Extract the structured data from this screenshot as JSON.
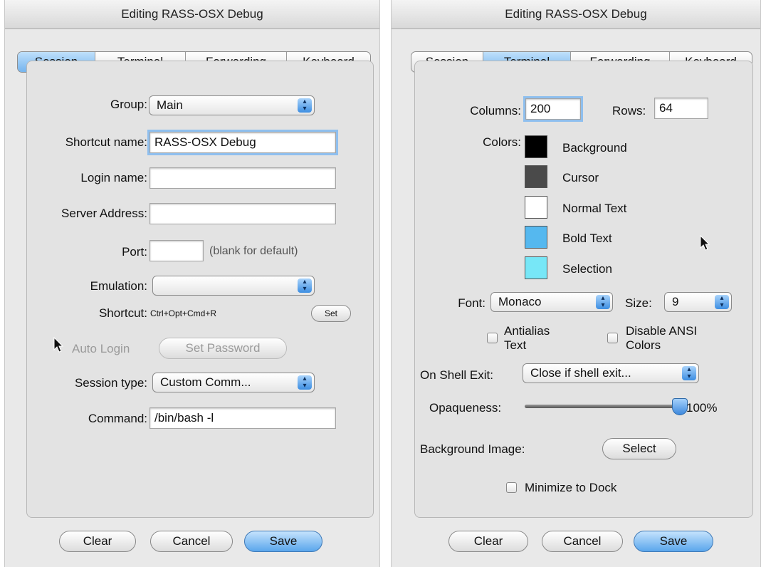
{
  "left": {
    "title": "Editing RASS-OSX Debug",
    "tabs": [
      "Session",
      "Terminal",
      "Forwarding",
      "Keyboard"
    ],
    "active_tab": "Session",
    "group_label": "Group:",
    "group_value": "Main",
    "shortcut_name_label": "Shortcut name:",
    "shortcut_name_value": "RASS-OSX Debug",
    "login_name_label": "Login name:",
    "login_name_value": "",
    "server_address_label": "Server Address:",
    "server_address_value": "",
    "port_label": "Port:",
    "port_value": "",
    "port_hint": "(blank for default)",
    "emulation_label": "Emulation:",
    "emulation_value": "",
    "shortcut_label": "Shortcut:",
    "shortcut_value": "Ctrl+Opt+Cmd+R",
    "set_button": "Set",
    "auto_login_label": "Auto Login",
    "set_password_button": "Set Password",
    "session_type_label": "Session type:",
    "session_type_value": "Custom Comm...",
    "command_label": "Command:",
    "command_value": "/bin/bash -l",
    "clear_button": "Clear",
    "cancel_button": "Cancel",
    "save_button": "Save"
  },
  "right": {
    "title": "Editing RASS-OSX Debug",
    "tabs": [
      "Session",
      "Terminal",
      "Forwarding",
      "Keyboard"
    ],
    "active_tab": "Terminal",
    "columns_label": "Columns:",
    "columns_value": "200",
    "rows_label": "Rows:",
    "rows_value": "64",
    "colors_label": "Colors:",
    "colors": [
      {
        "name": "Background",
        "color": "#000000"
      },
      {
        "name": "Cursor",
        "color": "#4a4a4a"
      },
      {
        "name": "Normal Text",
        "color": "#ffffff"
      },
      {
        "name": "Bold Text",
        "color": "#55b8ef"
      },
      {
        "name": "Selection",
        "color": "#77e7f7"
      }
    ],
    "font_label": "Font:",
    "font_value": "Monaco",
    "size_label": "Size:",
    "size_value": "9",
    "antialias_line1": "Antialias",
    "antialias_line2": "Text",
    "disable_ansi_line1": "Disable ANSI",
    "disable_ansi_line2": "Colors",
    "on_shell_exit_label": "On Shell Exit:",
    "on_shell_exit_value": "Close if shell exit...",
    "opaqueness_label": "Opaqueness:",
    "opaqueness_value": "100%",
    "opaqueness_fraction": 1.0,
    "background_image_label": "Background Image:",
    "select_button": "Select",
    "minimize_label": "Minimize to Dock",
    "clear_button": "Clear",
    "cancel_button": "Cancel",
    "save_button": "Save"
  },
  "accent_color": "#5aa6ec"
}
